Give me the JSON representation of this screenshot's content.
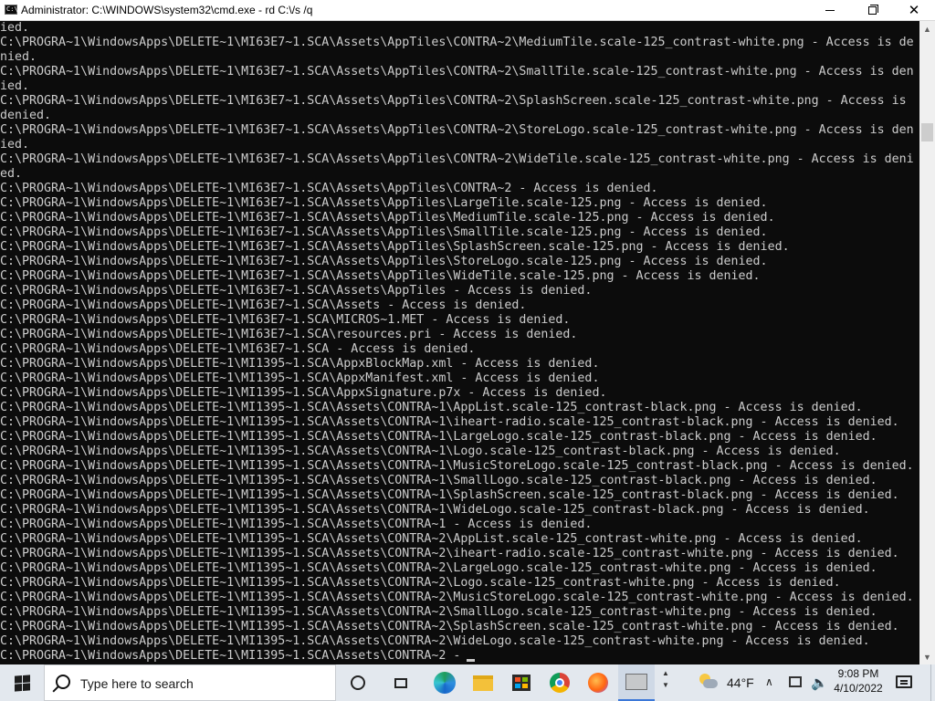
{
  "window": {
    "title": "Administrator: C:\\WINDOWS\\system32\\cmd.exe - rd  C:\\/s /q",
    "icon": "cmd-icon",
    "minimize_icon": "minimize-icon",
    "maximize_icon": "restore-icon",
    "close_icon": "close-icon"
  },
  "console": {
    "colors": {
      "background": "#0c0c0c",
      "text": "#cccccc"
    },
    "lines": [
      "ied.",
      "C:\\PROGRA~1\\WindowsApps\\DELETE~1\\MI63E7~1.SCA\\Assets\\AppTiles\\CONTRA~2\\MediumTile.scale-125_contrast-white.png - Access is de",
      "nied.",
      "C:\\PROGRA~1\\WindowsApps\\DELETE~1\\MI63E7~1.SCA\\Assets\\AppTiles\\CONTRA~2\\SmallTile.scale-125_contrast-white.png - Access is den",
      "ied.",
      "C:\\PROGRA~1\\WindowsApps\\DELETE~1\\MI63E7~1.SCA\\Assets\\AppTiles\\CONTRA~2\\SplashScreen.scale-125_contrast-white.png - Access is",
      "denied.",
      "C:\\PROGRA~1\\WindowsApps\\DELETE~1\\MI63E7~1.SCA\\Assets\\AppTiles\\CONTRA~2\\StoreLogo.scale-125_contrast-white.png - Access is den",
      "ied.",
      "C:\\PROGRA~1\\WindowsApps\\DELETE~1\\MI63E7~1.SCA\\Assets\\AppTiles\\CONTRA~2\\WideTile.scale-125_contrast-white.png - Access is deni",
      "ed.",
      "C:\\PROGRA~1\\WindowsApps\\DELETE~1\\MI63E7~1.SCA\\Assets\\AppTiles\\CONTRA~2 - Access is denied.",
      "C:\\PROGRA~1\\WindowsApps\\DELETE~1\\MI63E7~1.SCA\\Assets\\AppTiles\\LargeTile.scale-125.png - Access is denied.",
      "C:\\PROGRA~1\\WindowsApps\\DELETE~1\\MI63E7~1.SCA\\Assets\\AppTiles\\MediumTile.scale-125.png - Access is denied.",
      "C:\\PROGRA~1\\WindowsApps\\DELETE~1\\MI63E7~1.SCA\\Assets\\AppTiles\\SmallTile.scale-125.png - Access is denied.",
      "C:\\PROGRA~1\\WindowsApps\\DELETE~1\\MI63E7~1.SCA\\Assets\\AppTiles\\SplashScreen.scale-125.png - Access is denied.",
      "C:\\PROGRA~1\\WindowsApps\\DELETE~1\\MI63E7~1.SCA\\Assets\\AppTiles\\StoreLogo.scale-125.png - Access is denied.",
      "C:\\PROGRA~1\\WindowsApps\\DELETE~1\\MI63E7~1.SCA\\Assets\\AppTiles\\WideTile.scale-125.png - Access is denied.",
      "C:\\PROGRA~1\\WindowsApps\\DELETE~1\\MI63E7~1.SCA\\Assets\\AppTiles - Access is denied.",
      "C:\\PROGRA~1\\WindowsApps\\DELETE~1\\MI63E7~1.SCA\\Assets - Access is denied.",
      "C:\\PROGRA~1\\WindowsApps\\DELETE~1\\MI63E7~1.SCA\\MICROS~1.MET - Access is denied.",
      "C:\\PROGRA~1\\WindowsApps\\DELETE~1\\MI63E7~1.SCA\\resources.pri - Access is denied.",
      "C:\\PROGRA~1\\WindowsApps\\DELETE~1\\MI63E7~1.SCA - Access is denied.",
      "C:\\PROGRA~1\\WindowsApps\\DELETE~1\\MI1395~1.SCA\\AppxBlockMap.xml - Access is denied.",
      "C:\\PROGRA~1\\WindowsApps\\DELETE~1\\MI1395~1.SCA\\AppxManifest.xml - Access is denied.",
      "C:\\PROGRA~1\\WindowsApps\\DELETE~1\\MI1395~1.SCA\\AppxSignature.p7x - Access is denied.",
      "C:\\PROGRA~1\\WindowsApps\\DELETE~1\\MI1395~1.SCA\\Assets\\CONTRA~1\\AppList.scale-125_contrast-black.png - Access is denied.",
      "C:\\PROGRA~1\\WindowsApps\\DELETE~1\\MI1395~1.SCA\\Assets\\CONTRA~1\\iheart-radio.scale-125_contrast-black.png - Access is denied.",
      "C:\\PROGRA~1\\WindowsApps\\DELETE~1\\MI1395~1.SCA\\Assets\\CONTRA~1\\LargeLogo.scale-125_contrast-black.png - Access is denied.",
      "C:\\PROGRA~1\\WindowsApps\\DELETE~1\\MI1395~1.SCA\\Assets\\CONTRA~1\\Logo.scale-125_contrast-black.png - Access is denied.",
      "C:\\PROGRA~1\\WindowsApps\\DELETE~1\\MI1395~1.SCA\\Assets\\CONTRA~1\\MusicStoreLogo.scale-125_contrast-black.png - Access is denied.",
      "C:\\PROGRA~1\\WindowsApps\\DELETE~1\\MI1395~1.SCA\\Assets\\CONTRA~1\\SmallLogo.scale-125_contrast-black.png - Access is denied.",
      "C:\\PROGRA~1\\WindowsApps\\DELETE~1\\MI1395~1.SCA\\Assets\\CONTRA~1\\SplashScreen.scale-125_contrast-black.png - Access is denied.",
      "C:\\PROGRA~1\\WindowsApps\\DELETE~1\\MI1395~1.SCA\\Assets\\CONTRA~1\\WideLogo.scale-125_contrast-black.png - Access is denied.",
      "C:\\PROGRA~1\\WindowsApps\\DELETE~1\\MI1395~1.SCA\\Assets\\CONTRA~1 - Access is denied.",
      "C:\\PROGRA~1\\WindowsApps\\DELETE~1\\MI1395~1.SCA\\Assets\\CONTRA~2\\AppList.scale-125_contrast-white.png - Access is denied.",
      "C:\\PROGRA~1\\WindowsApps\\DELETE~1\\MI1395~1.SCA\\Assets\\CONTRA~2\\iheart-radio.scale-125_contrast-white.png - Access is denied.",
      "C:\\PROGRA~1\\WindowsApps\\DELETE~1\\MI1395~1.SCA\\Assets\\CONTRA~2\\LargeLogo.scale-125_contrast-white.png - Access is denied.",
      "C:\\PROGRA~1\\WindowsApps\\DELETE~1\\MI1395~1.SCA\\Assets\\CONTRA~2\\Logo.scale-125_contrast-white.png - Access is denied.",
      "C:\\PROGRA~1\\WindowsApps\\DELETE~1\\MI1395~1.SCA\\Assets\\CONTRA~2\\MusicStoreLogo.scale-125_contrast-white.png - Access is denied.",
      "C:\\PROGRA~1\\WindowsApps\\DELETE~1\\MI1395~1.SCA\\Assets\\CONTRA~2\\SmallLogo.scale-125_contrast-white.png - Access is denied.",
      "C:\\PROGRA~1\\WindowsApps\\DELETE~1\\MI1395~1.SCA\\Assets\\CONTRA~2\\SplashScreen.scale-125_contrast-white.png - Access is denied.",
      "C:\\PROGRA~1\\WindowsApps\\DELETE~1\\MI1395~1.SCA\\Assets\\CONTRA~2\\WideLogo.scale-125_contrast-white.png - Access is denied.",
      "C:\\PROGRA~1\\WindowsApps\\DELETE~1\\MI1395~1.SCA\\Assets\\CONTRA~2 -"
    ]
  },
  "taskbar": {
    "search_placeholder": "Type here to search",
    "apps": [
      {
        "name": "cortana-icon"
      },
      {
        "name": "task-view-icon"
      },
      {
        "name": "edge-icon"
      },
      {
        "name": "file-explorer-icon"
      },
      {
        "name": "microsoft-store-icon"
      },
      {
        "name": "chrome-icon"
      },
      {
        "name": "firefox-icon"
      },
      {
        "name": "command-prompt-icon",
        "active": true
      }
    ],
    "tray": {
      "weather_icon": "partly-cloudy-icon",
      "temperature": "44°F",
      "time": "9:08 PM",
      "date": "4/10/2022"
    }
  }
}
